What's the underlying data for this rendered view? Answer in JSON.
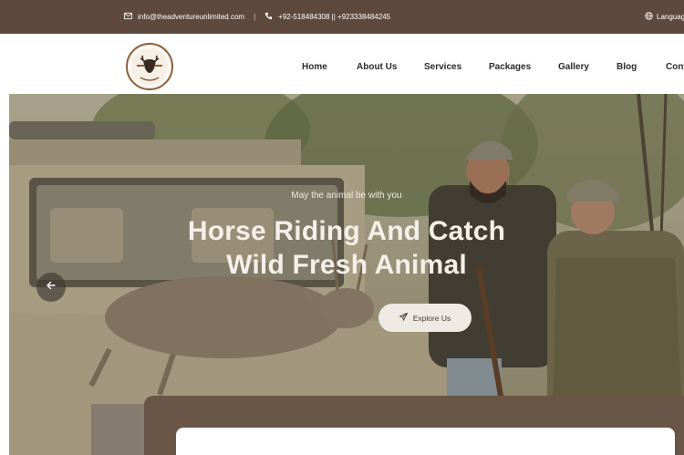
{
  "topbar": {
    "email": "info@theadventureunlimited.com",
    "separator": "|",
    "phone": "+92-518484308 || +923338484245",
    "language": "Language"
  },
  "header": {
    "logo_alt": "Adventure Unlimited"
  },
  "nav": {
    "items": [
      "Home",
      "About Us",
      "Services",
      "Packages",
      "Gallery",
      "Blog",
      "Cont"
    ]
  },
  "hero": {
    "tagline": "May the animal be with you",
    "headline_line1": "Horse Riding And Catch",
    "headline_line2": "Wild Fresh Animal",
    "cta_label": "Explore Us"
  },
  "colors": {
    "topbar_bg": "#5e4a3c",
    "panel_bg": "#6a5647",
    "button_bg": "#efe9e3"
  },
  "icons": [
    "mail-icon",
    "phone-icon",
    "globe-icon",
    "arrow-left-icon",
    "send-icon"
  ]
}
